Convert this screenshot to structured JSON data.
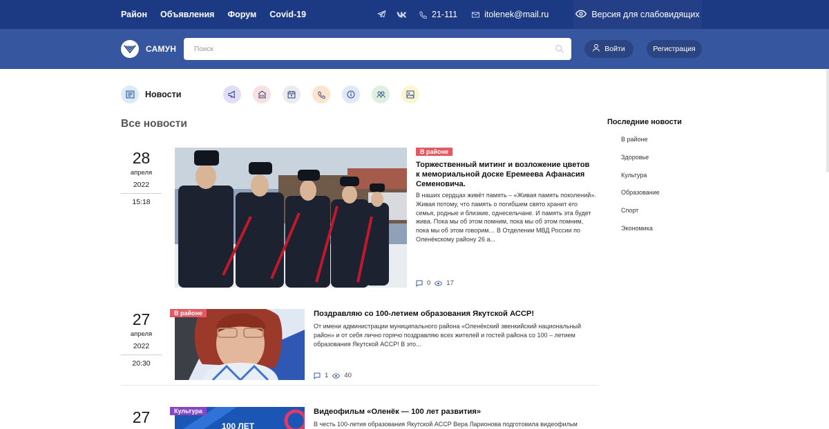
{
  "topbar": {
    "nav": [
      "Район",
      "Объявления",
      "Форум",
      "Covid-19"
    ],
    "phone": "21-111",
    "email": "itolenek@mail.ru",
    "vision_label": "Версия для слабовидящих",
    "bg_color": "#1c3a83"
  },
  "header": {
    "logo_text": "САМУН",
    "search_placeholder": "Поиск",
    "login_label": "Войти",
    "register_label": "Регистрация",
    "bg_color": "#3656a0"
  },
  "categories": {
    "news_label": "Новости",
    "icons": [
      {
        "name": "megaphone-icon",
        "color": "#e2ddf6"
      },
      {
        "name": "building-icon",
        "color": "#f9e1e1"
      },
      {
        "name": "calendar-icon",
        "color": "#ecebf0"
      },
      {
        "name": "phone-icon",
        "color": "#fde4cd"
      },
      {
        "name": "info-icon",
        "color": "#e0e9f7"
      },
      {
        "name": "people-icon",
        "color": "#def0df"
      },
      {
        "name": "image-icon",
        "color": "#fdf5cf"
      }
    ]
  },
  "section_title": "Все новости",
  "articles": [
    {
      "day": "28",
      "month": "апреля",
      "year": "2022",
      "time": "15:18",
      "tag": "В районе",
      "title": "Торжественный митинг и возложение цветов к мемориальной доске Еремеева Афанасия Семеновича.",
      "excerpt": "В наших сердцах живёт память – «Живая память поколений». Живая потому, что память о погибшем свято хранит его семья, родные и близкие, однесельчане. И память эта будет жива. Пока мы об этом помним, пока мы об этом помним, пока мы об этом говорим… В Отделении МВД России по Оленёкскому району 26 а...",
      "comments": "0",
      "views": "17"
    },
    {
      "day": "27",
      "month": "апреля",
      "year": "2022",
      "time": "20:30",
      "tag": "В районе",
      "title": "Поздравляю со 100-летием образования Якутской АССР!",
      "excerpt": "От имени администрации муниципального района «Оленёкский эвенкийский национальный район» и от себя лично горячо поздравляю всех жителей и гостей района со 100 – летием образования Якутской АССР! В это...",
      "comments": "1",
      "views": "40"
    },
    {
      "day": "27",
      "tag": "Культура",
      "title": "Видеофильм «Оленёк — 100 лет развития»",
      "excerpt": "В честь 100-летия образования Якутской АССР Вера Ларионова подготовила видеофильм",
      "image_text": "100 ЛЕТ"
    }
  ],
  "sidebar": {
    "title": "Последние новости",
    "items": [
      "В районе",
      "Здоровье",
      "Культура",
      "Образование",
      "Спорт",
      "Экономика"
    ]
  }
}
